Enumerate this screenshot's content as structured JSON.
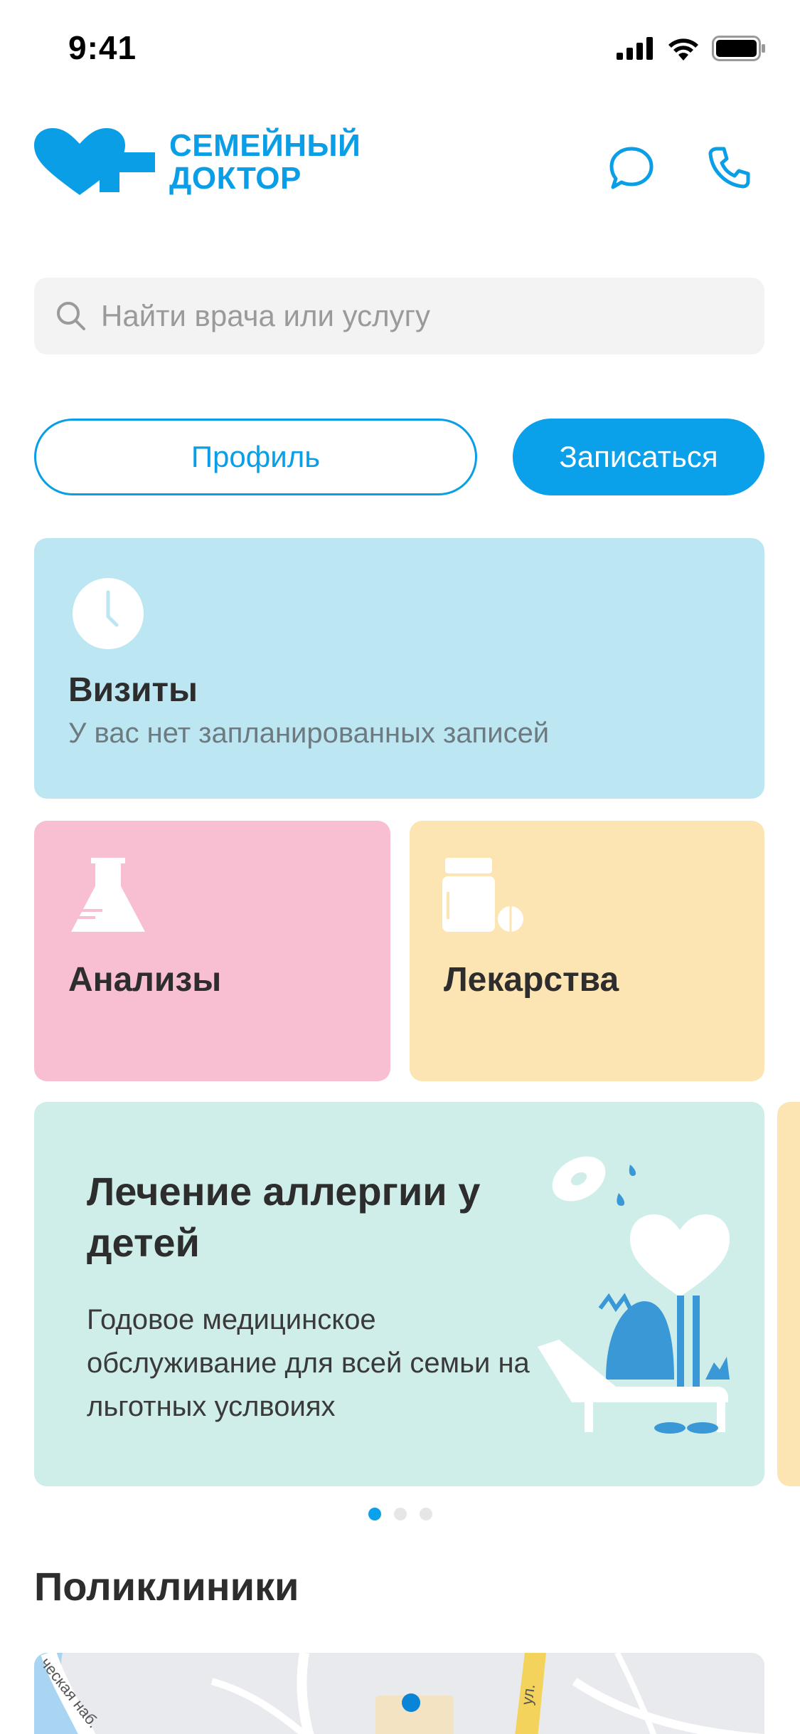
{
  "status_bar": {
    "time": "9:41"
  },
  "header": {
    "logo_line1": "СЕМЕЙНЫЙ",
    "logo_line2": "ДОКТОР",
    "chat_icon": "chat-bubble-icon",
    "phone_icon": "phone-icon"
  },
  "search": {
    "placeholder": "Найти врача или услугу",
    "value": ""
  },
  "actions": {
    "profile_label": "Профиль",
    "signup_label": "Записаться"
  },
  "visits": {
    "title": "Визиты",
    "subtitle": "У вас нет запланированных записей",
    "icon": "clock-icon"
  },
  "tests": {
    "title": "Анализы",
    "icon": "flask-icon"
  },
  "meds": {
    "title": "Лекарства",
    "icon": "pill-bottle-icon"
  },
  "promo": {
    "title": "Лечение аллергии у детей",
    "description": "Годовое медицинское обслуживание для всей семьи на льготных услвоиях",
    "active_slide": 1,
    "slide_count": 3
  },
  "clinics": {
    "title": "Поликлиники",
    "map_labels": [
      "ческая наб.",
      "ул."
    ]
  },
  "colors": {
    "accent": "#0aa0ea",
    "visits_bg": "#bde6f3",
    "tests_bg": "#f8bfd3",
    "meds_bg": "#fce5b2",
    "promo_bg": "#cfeeea"
  }
}
